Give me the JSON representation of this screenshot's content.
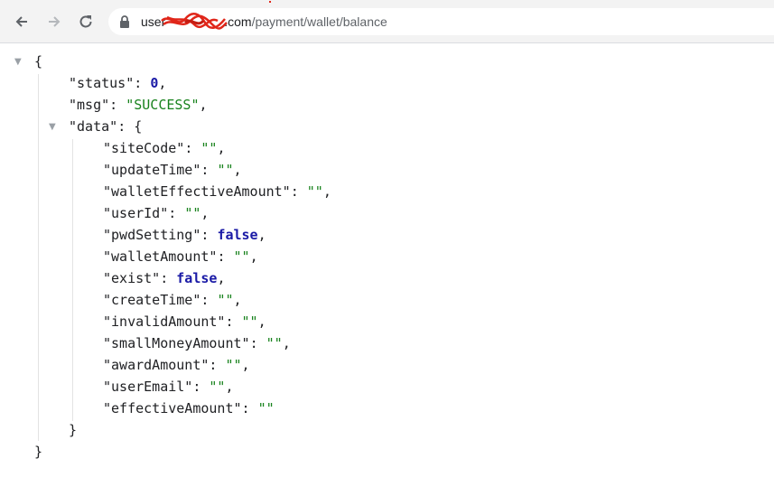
{
  "browser": {
    "url_host_prefix": "user",
    "url_host_suffix": ".com",
    "url_path": "/payment/wallet/balance",
    "icons": [
      "back-arrow-icon",
      "forward-arrow-icon",
      "reload-icon",
      "lock-icon"
    ]
  },
  "json_view": {
    "open_brace": "{",
    "close_brace": "}",
    "status": {
      "key": "\"status\"",
      "value": "0"
    },
    "msg": {
      "key": "\"msg\"",
      "value": "\"SUCCESS\""
    },
    "data": {
      "key": "\"data\"",
      "open": "{",
      "close": "}",
      "fields": [
        {
          "key": "\"siteCode\"",
          "value": "\"\"",
          "type": "string"
        },
        {
          "key": "\"updateTime\"",
          "value": "\"\"",
          "type": "string"
        },
        {
          "key": "\"walletEffectiveAmount\"",
          "value": "\"\"",
          "type": "string"
        },
        {
          "key": "\"userId\"",
          "value": "\"\"",
          "type": "string"
        },
        {
          "key": "\"pwdSetting\"",
          "value": "false",
          "type": "bool"
        },
        {
          "key": "\"walletAmount\"",
          "value": "\"\"",
          "type": "string"
        },
        {
          "key": "\"exist\"",
          "value": "false",
          "type": "bool"
        },
        {
          "key": "\"createTime\"",
          "value": "\"\"",
          "type": "string"
        },
        {
          "key": "\"invalidAmount\"",
          "value": "\"\"",
          "type": "string"
        },
        {
          "key": "\"smallMoneyAmount\"",
          "value": "\"\"",
          "type": "string"
        },
        {
          "key": "\"awardAmount\"",
          "value": "\"\"",
          "type": "string"
        },
        {
          "key": "\"userEmail\"",
          "value": "\"\"",
          "type": "string"
        },
        {
          "key": "\"effectiveAmount\"",
          "value": "\"\"",
          "type": "string"
        }
      ]
    },
    "colors": {
      "number_bool": "#1a1aa6",
      "string": "#17821c",
      "text": "#202124"
    }
  }
}
